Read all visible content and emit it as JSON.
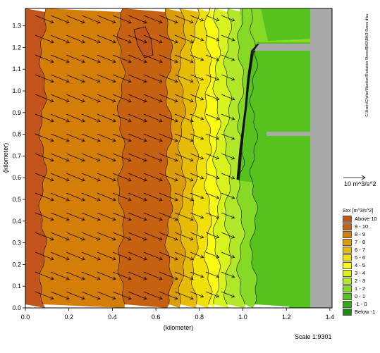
{
  "map": {
    "x_axis_label": "(kilometer)",
    "y_axis_label": "(kilometer)",
    "x_ticks": [
      "0.0",
      "0.2",
      "0.4",
      "0.6",
      "0.8",
      "1.0",
      "1.2",
      "1.4"
    ],
    "y_ticks": [
      "0.0",
      "0.1",
      "0.2",
      "0.3",
      "0.4",
      "0.5",
      "0.6",
      "0.7",
      "0.8",
      "0.9",
      "1.0",
      "1.1",
      "1.2",
      "1.3"
    ],
    "x_range": [
      0.0,
      1.41
    ],
    "y_range": [
      0.0,
      1.38
    ],
    "scale_text": "Scale 1:9301",
    "side_text": "C:\\Users\\Chetan\\Bastkan\\Radiation Stress\\BW3\\BW3-Stress.dfsu",
    "vector_legend_label": "10 m^3/s^2"
  },
  "legend": {
    "title": "Sxx [m^3/s^2]",
    "items": [
      {
        "label": "Above 10",
        "color": "#c2541b"
      },
      {
        "label": "9 - 10",
        "color": "#c76112"
      },
      {
        "label": "8 - 9",
        "color": "#d47e0a"
      },
      {
        "label": "7 - 8",
        "color": "#dc9b08"
      },
      {
        "label": "6 - 7",
        "color": "#e7bc07"
      },
      {
        "label": "5 - 6",
        "color": "#f2e00a"
      },
      {
        "label": "4 - 5",
        "color": "#f9fb12"
      },
      {
        "label": "3 - 4",
        "color": "#d8f21e"
      },
      {
        "label": "2 - 3",
        "color": "#b2e82a"
      },
      {
        "label": "1 - 2",
        "color": "#86d925"
      },
      {
        "label": "0 - 1",
        "color": "#55c21d"
      },
      {
        "label": "-1 - 0",
        "color": "#2fab19"
      },
      {
        "label": "Below -1",
        "color": "#1b8c14"
      }
    ]
  },
  "chart_data": {
    "type": "heatmap",
    "title": "",
    "xlabel": "(kilometer)",
    "ylabel": "(kilometer)",
    "xlim": [
      0.0,
      1.41
    ],
    "ylim": [
      0.0,
      1.38
    ],
    "bands": [
      {
        "x_from": 0.0,
        "x_to": 0.08,
        "class": "Above 10"
      },
      {
        "x_from": 0.08,
        "x_to": 0.44,
        "class": "8 - 9"
      },
      {
        "x_from": 0.44,
        "x_to": 0.66,
        "class": "9 - 10"
      },
      {
        "x_from": 0.66,
        "x_to": 0.72,
        "class": "7 - 8"
      },
      {
        "x_from": 0.72,
        "x_to": 0.78,
        "class": "6 - 7"
      },
      {
        "x_from": 0.78,
        "x_to": 0.84,
        "class": "5 - 6"
      },
      {
        "x_from": 0.84,
        "x_to": 0.88,
        "class": "4 - 5"
      },
      {
        "x_from": 0.88,
        "x_to": 0.93,
        "class": "3 - 4"
      },
      {
        "x_from": 0.93,
        "x_to": 0.99,
        "class": "2 - 3"
      },
      {
        "x_from": 0.99,
        "x_to": 1.05,
        "class": "1 - 2"
      },
      {
        "x_from": 1.05,
        "x_to": 1.32,
        "class": "0 - 1"
      }
    ],
    "land_x_from": 1.32,
    "hotspot": {
      "x": 0.55,
      "y": 1.25,
      "class": "Above 10"
    }
  }
}
